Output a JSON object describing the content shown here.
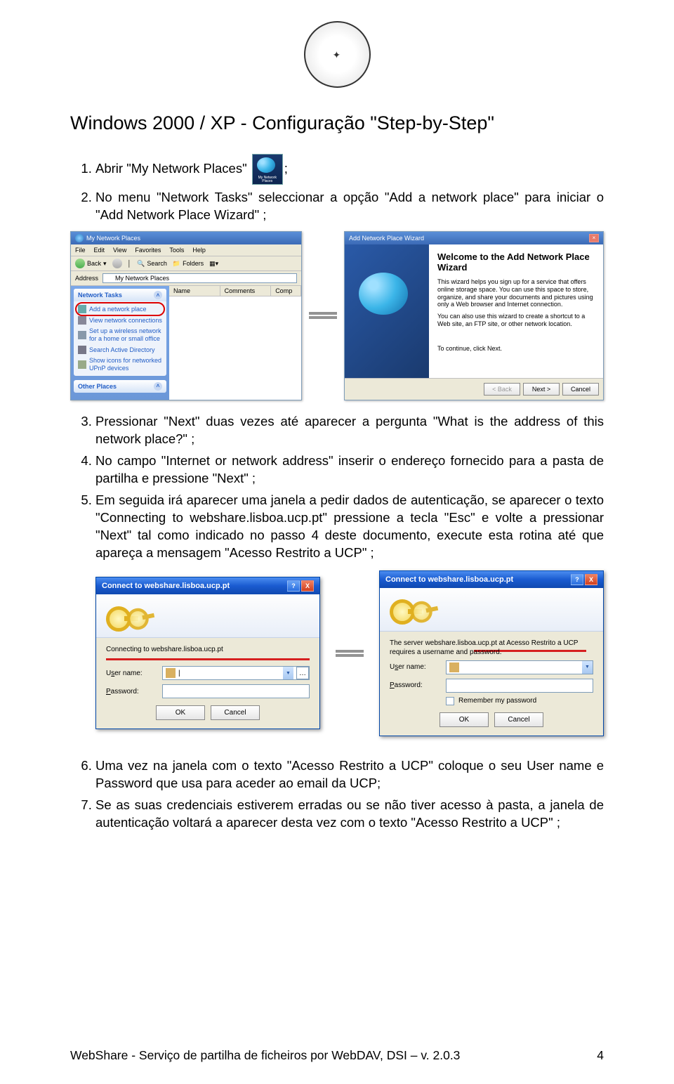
{
  "logo_alt": "Universidade Católica Lusitana seal",
  "heading": "Windows 2000 / XP - Configuração \"Step-by-Step\"",
  "steps_1_2": [
    "Abrir \"My Network Places\"",
    "No menu \"Network Tasks\" seleccionar a opção \"Add a network place\" para iniciar o \"Add Network Place Wizard\" ;"
  ],
  "step1_suffix": ";",
  "explorer": {
    "title": "My Network Places",
    "menu": [
      "File",
      "Edit",
      "View",
      "Favorites",
      "Tools",
      "Help"
    ],
    "toolbar": {
      "back": "Back",
      "search": "Search",
      "folders": "Folders"
    },
    "address_label": "Address",
    "address_value": "My Network Places",
    "columns": [
      "Name",
      "Comments",
      "Comp"
    ],
    "panels": {
      "network_tasks": {
        "title": "Network Tasks",
        "items": [
          "Add a network place",
          "View network connections",
          "Set up a wireless network for a home or small office",
          "Search Active Directory",
          "Show icons for networked UPnP devices"
        ]
      },
      "other_places": {
        "title": "Other Places"
      }
    }
  },
  "wizard": {
    "title": "Add Network Place Wizard",
    "heading": "Welcome to the Add Network Place Wizard",
    "body1": "This wizard helps you sign up for a service that offers online storage space. You can use this space to store, organize, and share your documents and pictures using only a Web browser and Internet connection.",
    "body2": "You can also use this wizard to create a shortcut to a Web site, an FTP site, or other network location.",
    "continue": "To continue, click Next.",
    "buttons": {
      "back": "< Back",
      "next": "Next >",
      "cancel": "Cancel"
    }
  },
  "steps_3_5": [
    "Pressionar \"Next\" duas vezes até aparecer a pergunta \"What is the address of this network place?\" ;",
    "No campo \"Internet or network address\" inserir o endereço fornecido para a pasta de partilha e pressione \"Next\" ;",
    "Em seguida irá aparecer uma janela a pedir dados de autenticação, se aparecer o texto \"Connecting to webshare.lisboa.ucp.pt\" pressione a tecla \"Esc\" e volte a pressionar \"Next\" tal como indicado no passo 4 deste documento, execute esta rotina até que apareça a mensagem \"Acesso Restrito a UCP\" ;"
  ],
  "auth": {
    "title": "Connect to webshare.lisboa.ucp.pt",
    "help": "?",
    "close": "X",
    "msg_connecting": "Connecting to webshare.lisboa.ucp.pt",
    "msg_server": "The server webshare.lisboa.ucp.pt at Acesso Restrito a UCP requires a username and password.",
    "user_label_pre": "U",
    "user_label_ul": "s",
    "user_label_post": "er name:",
    "pass_label_pre": "",
    "pass_label_ul": "P",
    "pass_label_post": "assword:",
    "remember": "Remember my password",
    "remember_ul": "R",
    "ok": "OK",
    "cancel": "Cancel",
    "cursor": "|"
  },
  "steps_6_7": [
    "Uma vez na janela com o texto \"Acesso Restrito a UCP\" coloque o seu User name e Password que usa para aceder ao email da UCP;",
    "Se as suas credenciais estiverem erradas ou se não tiver acesso à pasta, a janela de autenticação voltará a aparecer desta vez com o texto \"Acesso Restrito a UCP\" ;"
  ],
  "footer": {
    "left": "WebShare - Serviço de partilha de ficheiros por WebDAV, DSI – v. 2.0.3",
    "right": "4"
  }
}
